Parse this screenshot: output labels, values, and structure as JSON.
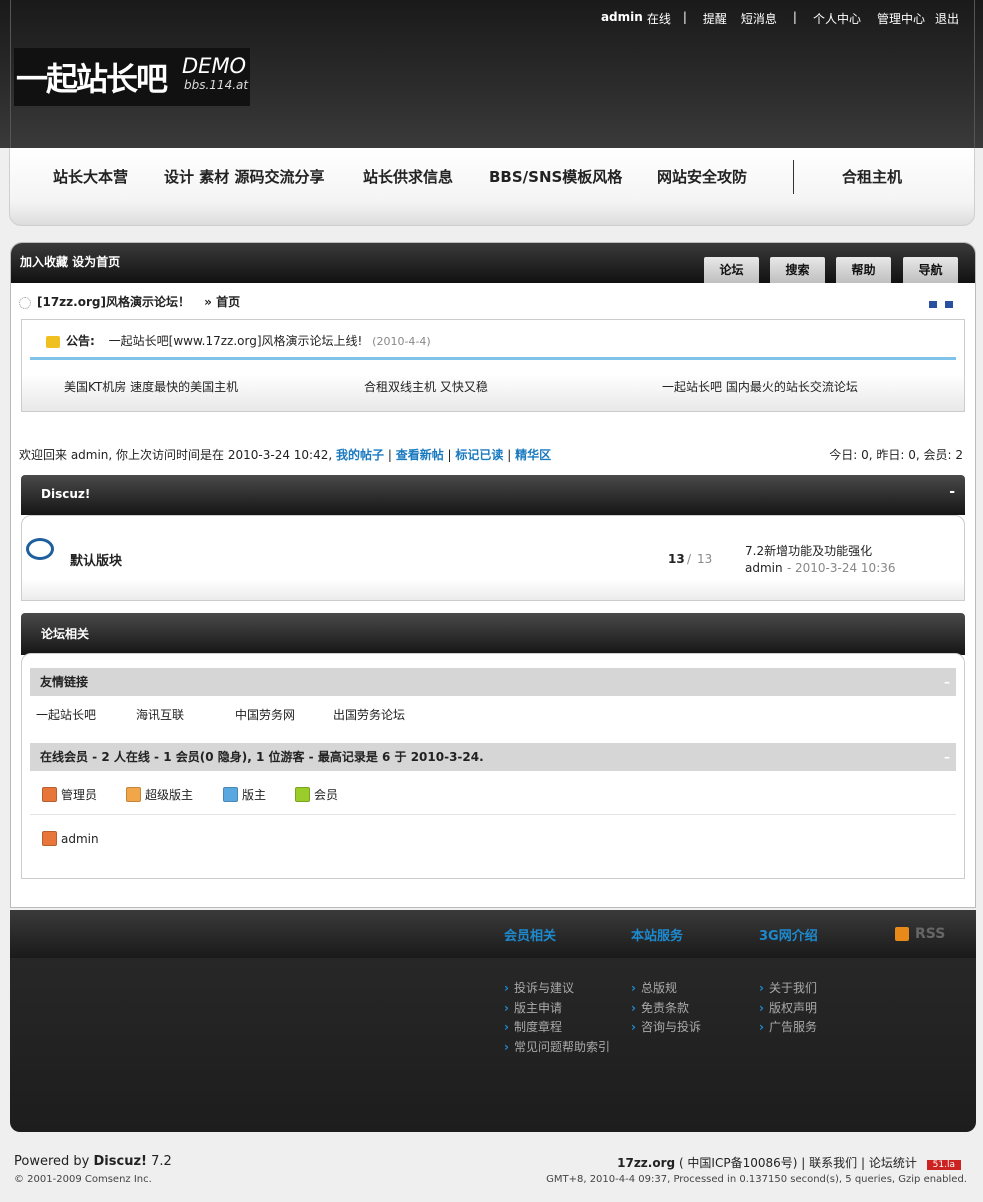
{
  "top": {
    "user": "admin",
    "status": "在线",
    "links": [
      "提醒",
      "短消息",
      "个人中心",
      "管理中心",
      "退出"
    ]
  },
  "logo": {
    "main": "一起站长吧",
    "demo": "DEMO",
    "url": "bbs.114.at"
  },
  "nav": [
    "站长大本营",
    "设计 素材 源码交流分享",
    "站长供求信息",
    "BBS/SNS模板风格",
    "网站安全攻防",
    "合租主机"
  ],
  "header": {
    "fav": "加入收藏 设为首页",
    "tabs": [
      "论坛",
      "搜索",
      "帮助",
      "导航"
    ]
  },
  "crumb": {
    "site": "[17zz.org]风格演示论坛！",
    "sep": "»",
    "home": "首页"
  },
  "notice": {
    "label": "公告:",
    "text": "一起站长吧[www.17zz.org]风格演示论坛上线!",
    "date": "(2010-4-4)",
    "ads": [
      "美国KT机房 速度最快的美国主机",
      "合租双线主机 又快又稳",
      "一起站长吧 国内最火的站长交流论坛"
    ]
  },
  "welcome": {
    "text": "欢迎回来 admin, 你上次访问时间是在 2010-3-24 10:42,",
    "links": [
      "我的帖子",
      "查看新帖",
      "标记已读",
      "精华区"
    ],
    "stats": "今日: 0, 昨日: 0, 会员: 2"
  },
  "category": {
    "title": "Discuz!",
    "collapse": "-",
    "forum": {
      "name": "默认版块",
      "threads": "13",
      "posts": "13",
      "last_title": "7.2新增功能及功能强化",
      "last_user": "admin",
      "last_time": "2010-3-24 10:36"
    }
  },
  "related": {
    "title": "论坛相关",
    "friends": {
      "title": "友情链接",
      "links": [
        "一起站长吧",
        "海讯互联",
        "中国劳务网",
        "出国劳务论坛"
      ]
    },
    "online": {
      "title": "在线会员 - 2 人在线 - 1 会员(0 隐身), 1 位游客 - 最高记录是 6 于 2010-3-24.",
      "legend": [
        "管理员",
        "超级版主",
        "版主",
        "会员"
      ],
      "users": [
        "admin"
      ]
    }
  },
  "footer": {
    "cols": [
      {
        "title": "会员相关",
        "items": [
          "投诉与建议",
          "版主申请",
          "制度章程",
          "常见问题帮助索引"
        ]
      },
      {
        "title": "本站服务",
        "items": [
          "总版规",
          "免责条款",
          "咨询与投诉"
        ]
      },
      {
        "title": "3G网介绍",
        "items": [
          "关于我们",
          "版权声明",
          "广告服务"
        ]
      }
    ],
    "rss": "RSS"
  },
  "bottom": {
    "powered": "Powered by",
    "brand": "Discuz!",
    "ver": "7.2",
    "copy": "© 2001-2009 Comsenz Inc.",
    "site": "17zz.org",
    "icp": "( 中国ICP备10086号)",
    "contact": "联系我们",
    "statlink": "论坛统计",
    "badge": "51.la",
    "processed": "GMT+8, 2010-4-4 09:37, Processed in 0.137150 second(s), 5 queries, Gzip enabled."
  }
}
